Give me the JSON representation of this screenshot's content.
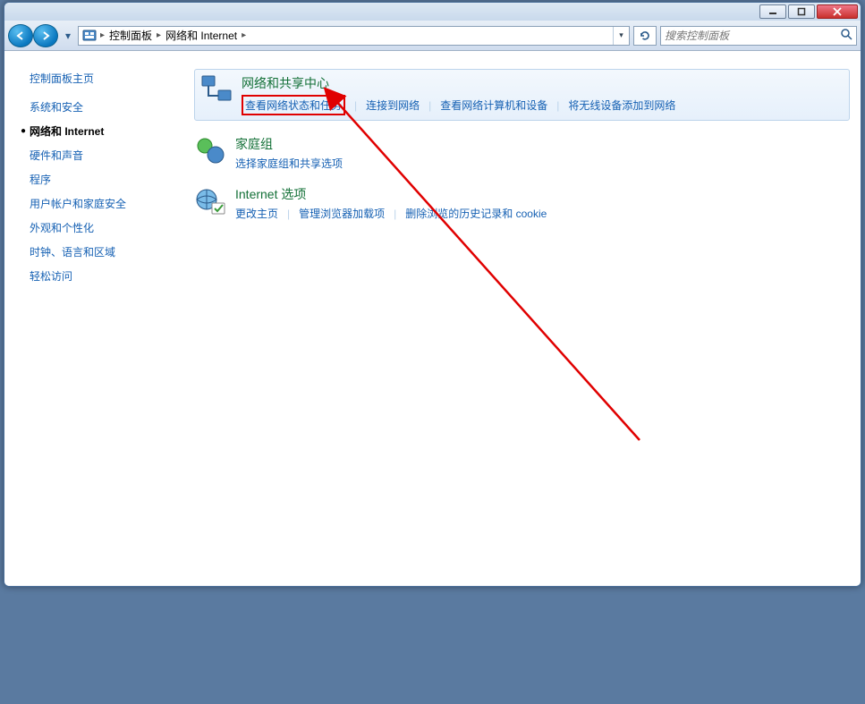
{
  "address": {
    "crumb1": "控制面板",
    "crumb2": "网络和 Internet"
  },
  "search": {
    "placeholder": "搜索控制面板"
  },
  "sidebar": {
    "title": "控制面板主页",
    "items": [
      {
        "label": "系统和安全"
      },
      {
        "label": "网络和 Internet"
      },
      {
        "label": "硬件和声音"
      },
      {
        "label": "程序"
      },
      {
        "label": "用户帐户和家庭安全"
      },
      {
        "label": "外观和个性化"
      },
      {
        "label": "时钟、语言和区域"
      },
      {
        "label": "轻松访问"
      }
    ],
    "active_index": 1
  },
  "sections": [
    {
      "title": "网络和共享中心",
      "links": [
        "查看网络状态和任务",
        "连接到网络",
        "查看网络计算机和设备",
        "将无线设备添加到网络"
      ],
      "highlighted": true,
      "redbox_index": 0,
      "icon": "network-share"
    },
    {
      "title": "家庭组",
      "links": [
        "选择家庭组和共享选项"
      ],
      "icon": "homegroup"
    },
    {
      "title": "Internet 选项",
      "links": [
        "更改主页",
        "管理浏览器加载项",
        "删除浏览的历史记录和 cookie"
      ],
      "icon": "internet-options"
    }
  ]
}
